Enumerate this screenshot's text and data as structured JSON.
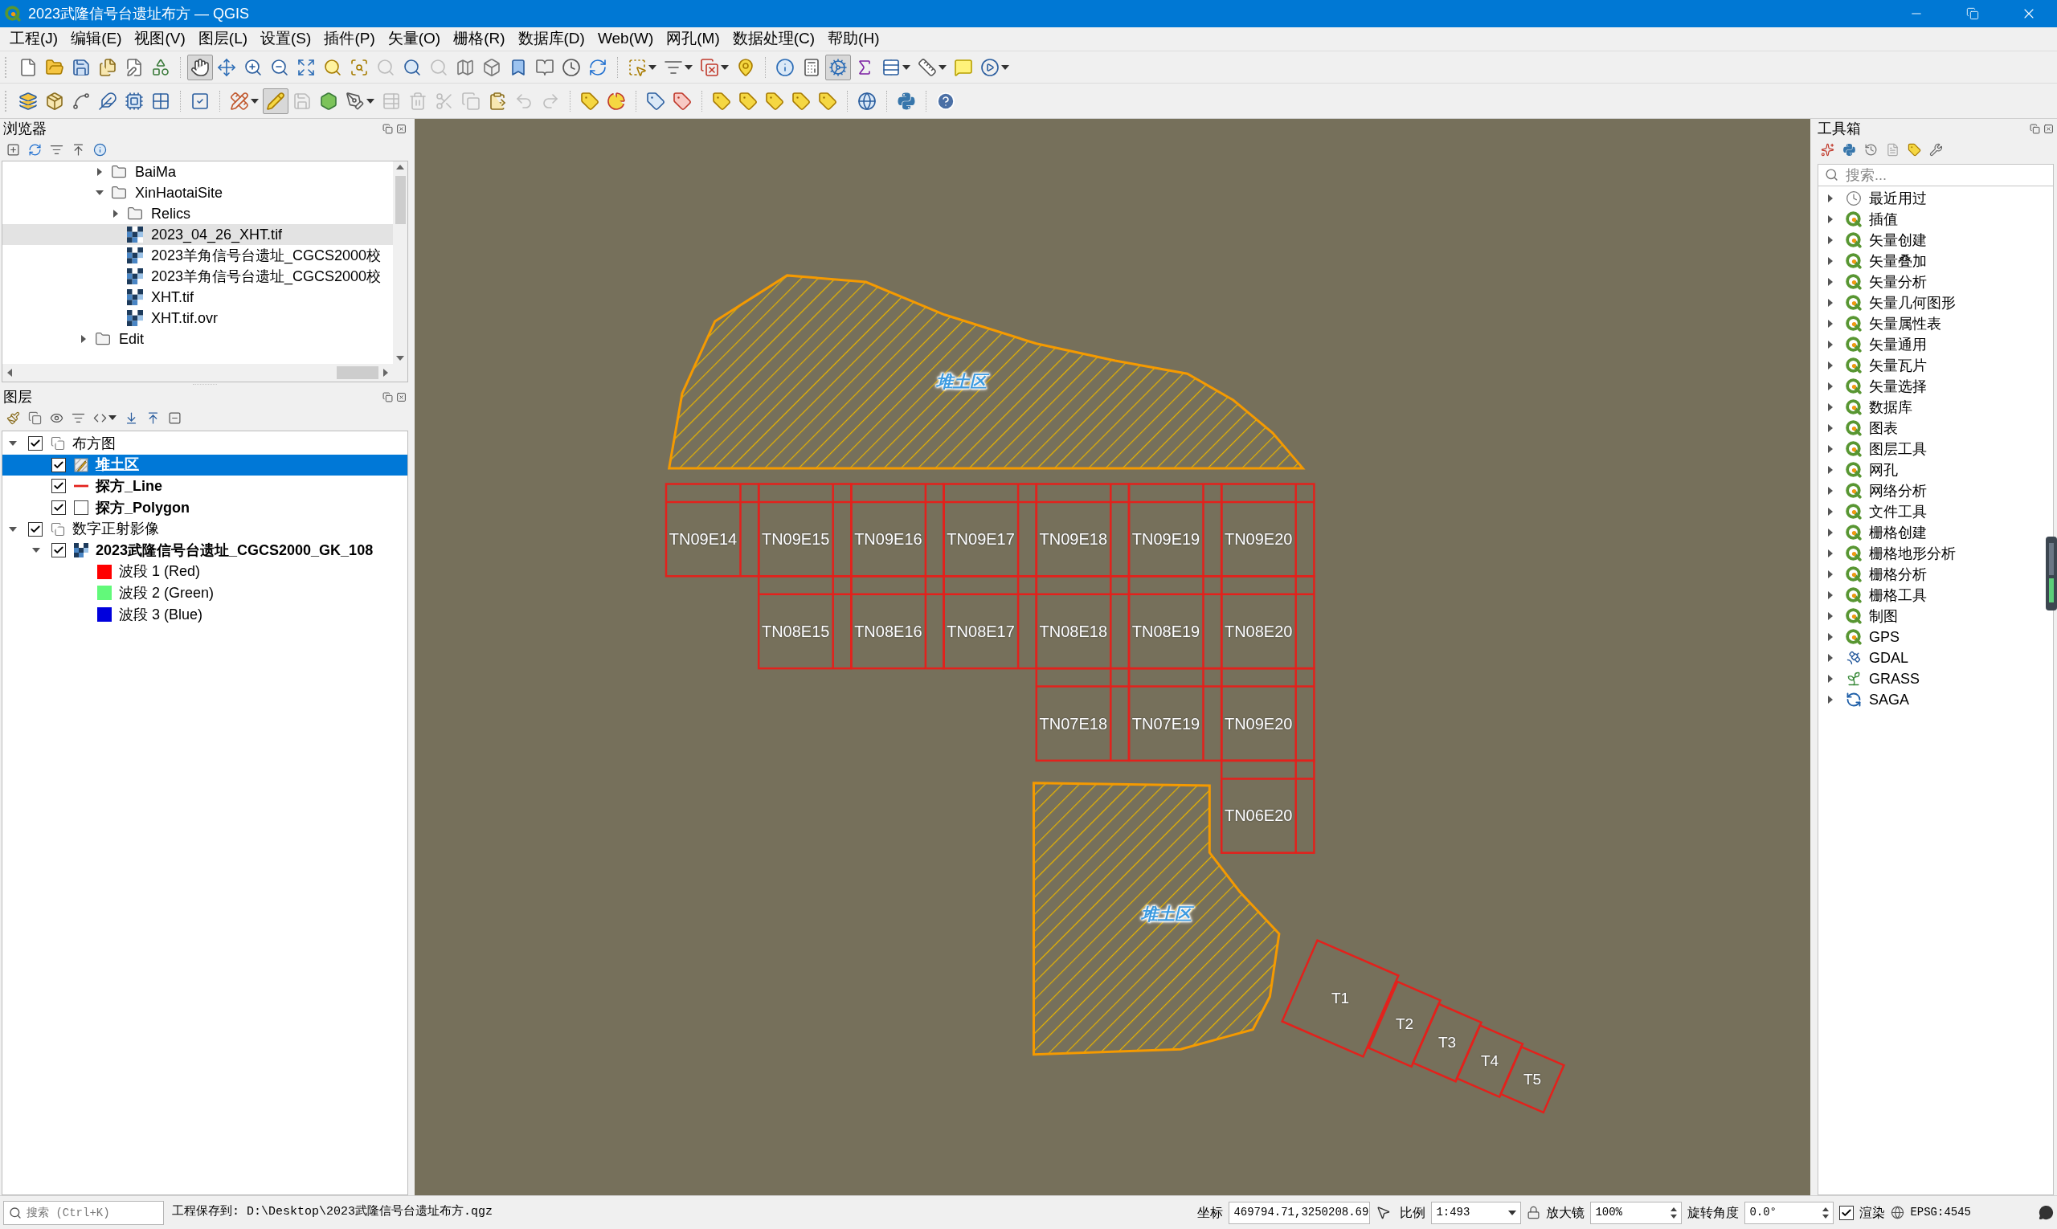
{
  "window": {
    "title": "2023武隆信号台遗址布方 — QGIS"
  },
  "menu": [
    "工程(J)",
    "编辑(E)",
    "视图(V)",
    "图层(L)",
    "设置(S)",
    "插件(P)",
    "矢量(O)",
    "栅格(R)",
    "数据库(D)",
    "Web(W)",
    "网孔(M)",
    "数据处理(C)",
    "帮助(H)"
  ],
  "toolbars": [
    {
      "items": [
        {
          "selected": false,
          "disabled": false
        },
        {
          "selected": false,
          "disabled": false
        },
        {
          "selected": false,
          "disabled": false
        },
        {
          "selected": false,
          "disabled": false
        },
        {
          "selected": false,
          "disabled": false
        },
        {
          "selected": false,
          "disabled": false
        },
        {
          "selected": true,
          "disabled": false
        },
        {
          "selected": false,
          "disabled": false
        },
        {
          "selected": false,
          "disabled": false
        },
        {
          "selected": false,
          "disabled": false
        },
        {
          "selected": false,
          "disabled": false
        },
        {
          "selected": false,
          "disabled": false
        },
        {
          "selected": false,
          "disabled": false
        },
        {
          "selected": false,
          "disabled": true
        },
        {
          "selected": false,
          "disabled": false
        },
        {
          "selected": false,
          "disabled": true
        },
        {
          "selected": false,
          "disabled": false
        },
        {
          "selected": false,
          "disabled": false
        },
        {
          "selected": false,
          "disabled": false
        },
        {
          "selected": false,
          "disabled": false
        },
        {
          "selected": false,
          "disabled": false
        },
        {
          "selected": false,
          "disabled": false
        },
        {
          "selected": false,
          "disabled": false
        },
        {
          "selected": false,
          "disabled": false
        },
        {
          "selected": false,
          "disabled": false
        },
        {
          "selected": false,
          "disabled": false
        },
        {
          "selected": false,
          "disabled": false
        },
        {
          "selected": false,
          "disabled": false
        },
        {
          "selected": true,
          "disabled": false
        },
        {
          "selected": false,
          "disabled": false
        },
        {
          "selected": false,
          "disabled": false
        },
        {
          "selected": false,
          "disabled": false
        },
        {
          "selected": false,
          "disabled": false
        },
        {
          "selected": false,
          "disabled": false
        }
      ]
    },
    {
      "items": [
        {
          "selected": false,
          "disabled": false
        },
        {
          "selected": false,
          "disabled": false
        },
        {
          "selected": false,
          "disabled": false
        },
        {
          "selected": false,
          "disabled": false
        },
        {
          "selected": false,
          "disabled": false
        },
        {
          "selected": false,
          "disabled": false
        },
        {
          "selected": false,
          "disabled": false
        },
        {
          "selected": false,
          "disabled": false
        },
        {
          "selected": true,
          "disabled": false
        },
        {
          "selected": false,
          "disabled": true
        },
        {
          "selected": false,
          "disabled": false
        },
        {
          "selected": false,
          "disabled": false
        },
        {
          "selected": false,
          "disabled": true
        },
        {
          "selected": false,
          "disabled": true
        },
        {
          "selected": false,
          "disabled": true
        },
        {
          "selected": false,
          "disabled": true
        },
        {
          "selected": false,
          "disabled": false
        },
        {
          "selected": false,
          "disabled": true
        },
        {
          "selected": false,
          "disabled": true
        },
        {
          "selected": false,
          "disabled": false
        },
        {
          "selected": false,
          "disabled": false
        },
        {
          "selected": false,
          "disabled": false
        },
        {
          "selected": false,
          "disabled": false
        },
        {
          "selected": false,
          "disabled": false
        },
        {
          "selected": false,
          "disabled": false
        },
        {
          "selected": false,
          "disabled": false
        },
        {
          "selected": false,
          "disabled": false
        },
        {
          "selected": false,
          "disabled": false
        },
        {
          "selected": false,
          "disabled": false
        },
        {
          "selected": false,
          "disabled": false
        },
        {
          "selected": false,
          "disabled": false
        }
      ]
    }
  ],
  "browser": {
    "title": "浏览器",
    "tree": [
      {
        "children": [
          {
            "label": "BaiMa",
            "kind": "folder",
            "expanded": false,
            "selected": false
          },
          {
            "label": "XinHaotaiSite",
            "kind": "folder",
            "expanded": true,
            "selected": false,
            "children": [
              {
                "label": "Relics",
                "kind": "folder",
                "expanded": false,
                "selected": false
              },
              {
                "label": "2023_04_26_XHT.tif",
                "kind": "raster",
                "selected": true
              },
              {
                "label": "2023羊角信号台遗址_CGCS2000校",
                "kind": "raster",
                "selected": false
              },
              {
                "label": "2023羊角信号台遗址_CGCS2000校",
                "kind": "raster",
                "selected": false
              },
              {
                "label": "XHT.tif",
                "kind": "raster",
                "selected": false
              },
              {
                "label": "XHT.tif.ovr",
                "kind": "raster",
                "selected": false
              }
            ]
          }
        ]
      },
      {
        "label": "Edit",
        "kind": "folder",
        "expanded": false,
        "selected": false
      }
    ]
  },
  "layers": {
    "title": "图层",
    "tree": [
      {
        "label": "布方图",
        "kind": "group",
        "checked": true,
        "expanded": true,
        "selected": false,
        "children": [
          {
            "label": "堆土区",
            "kind": "editing",
            "checked": true,
            "selected": true
          },
          {
            "label": "探方_Line",
            "kind": "line",
            "checked": true,
            "selected": false
          },
          {
            "label": "探方_Polygon",
            "kind": "fill",
            "checked": true,
            "selected": false
          }
        ]
      },
      {
        "label": "数字正射影像",
        "kind": "group",
        "checked": true,
        "expanded": true,
        "selected": false,
        "children": [
          {
            "label": "2023武隆信号台遗址_CGCS2000_GK_108",
            "kind": "raster",
            "checked": true,
            "expanded": true,
            "selected": false,
            "bands": [
              {
                "label": "波段 1 (Red)",
                "color": "#ff0000"
              },
              {
                "label": "波段 2 (Green)",
                "color": "#62f97a"
              },
              {
                "label": "波段 3 (Blue)",
                "color": "#0000dd"
              }
            ]
          }
        ]
      }
    ]
  },
  "toolbox": {
    "title": "工具箱",
    "search": {
      "placeholder": "搜索..."
    },
    "items": [
      {
        "label": "最近用过",
        "kind": "recent",
        "expanded": false
      },
      {
        "label": "插值",
        "kind": "qgis",
        "expanded": false
      },
      {
        "label": "矢量创建",
        "kind": "qgis",
        "expanded": false
      },
      {
        "label": "矢量叠加",
        "kind": "qgis",
        "expanded": false
      },
      {
        "label": "矢量分析",
        "kind": "qgis",
        "expanded": false
      },
      {
        "label": "矢量几何图形",
        "kind": "qgis",
        "expanded": false
      },
      {
        "label": "矢量属性表",
        "kind": "qgis",
        "expanded": false
      },
      {
        "label": "矢量通用",
        "kind": "qgis",
        "expanded": false
      },
      {
        "label": "矢量瓦片",
        "kind": "qgis",
        "expanded": false
      },
      {
        "label": "矢量选择",
        "kind": "qgis",
        "expanded": false
      },
      {
        "label": "数据库",
        "kind": "qgis",
        "expanded": false
      },
      {
        "label": "图表",
        "kind": "qgis",
        "expanded": false
      },
      {
        "label": "图层工具",
        "kind": "qgis",
        "expanded": false
      },
      {
        "label": "网孔",
        "kind": "qgis",
        "expanded": false
      },
      {
        "label": "网络分析",
        "kind": "qgis",
        "expanded": false
      },
      {
        "label": "文件工具",
        "kind": "qgis",
        "expanded": false
      },
      {
        "label": "栅格创建",
        "kind": "qgis",
        "expanded": false
      },
      {
        "label": "栅格地形分析",
        "kind": "qgis",
        "expanded": false
      },
      {
        "label": "栅格分析",
        "kind": "qgis",
        "expanded": false
      },
      {
        "label": "栅格工具",
        "kind": "qgis",
        "expanded": false
      },
      {
        "label": "制图",
        "kind": "qgis",
        "expanded": false
      },
      {
        "label": "GPS",
        "kind": "qgis",
        "expanded": false
      },
      {
        "label": "GDAL",
        "kind": "gdal",
        "expanded": false
      },
      {
        "label": "GRASS",
        "kind": "grass",
        "expanded": false
      },
      {
        "label": "SAGA",
        "kind": "saga",
        "expanded": false
      }
    ]
  },
  "map": {
    "zones": [
      {
        "label": "堆土区"
      },
      {
        "label": "堆土区"
      }
    ],
    "squares": [
      {
        "label": "TN09E14"
      },
      {
        "label": "TN09E15"
      },
      {
        "label": "TN09E16"
      },
      {
        "label": "TN09E17"
      },
      {
        "label": "TN09E18"
      },
      {
        "label": "TN09E19"
      },
      {
        "label": "TN09E20"
      },
      {
        "label": "TN08E15"
      },
      {
        "label": "TN08E16"
      },
      {
        "label": "TN08E17"
      },
      {
        "label": "TN08E18"
      },
      {
        "label": "TN08E19"
      },
      {
        "label": "TN08E20"
      },
      {
        "label": "TN07E18"
      },
      {
        "label": "TN07E19"
      },
      {
        "label": "TN09E20"
      },
      {
        "label": "TN06E20"
      }
    ],
    "trenches": [
      {
        "label": "T1"
      },
      {
        "label": "T2"
      },
      {
        "label": "T3"
      },
      {
        "label": "T4"
      },
      {
        "label": "T5"
      }
    ]
  },
  "status_bar": {
    "search": {
      "placeholder": "搜索 (Ctrl+K)"
    },
    "message": "工程保存到: D:\\Desktop\\2023武隆信号台遗址布方.qgz",
    "coordinate": {
      "label": "坐标",
      "value": "469794.71,3250208.69"
    },
    "scale": {
      "label": "比例",
      "value": "1:493"
    },
    "magnifier": {
      "label": "放大镜",
      "value": "100%"
    },
    "rotation": {
      "label": "旋转角度",
      "value": "0.0°"
    },
    "render": {
      "label": "渲染",
      "checked": true
    },
    "crs": "EPSG:4545"
  }
}
